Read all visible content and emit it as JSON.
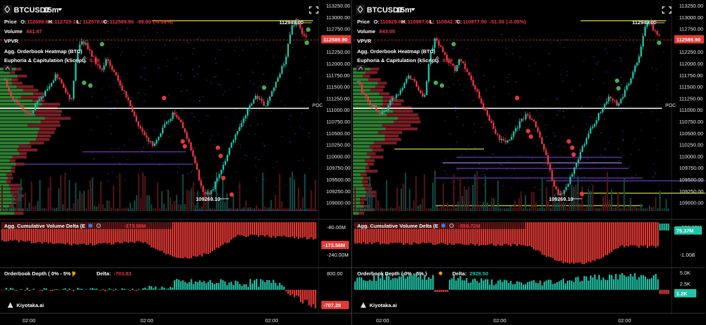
{
  "panels": [
    {
      "symbol": "BTCUSDT",
      "interval": "15m",
      "price_label": "Price",
      "ohlc": {
        "o": "112689.80",
        "h": "112729.10",
        "l": "112570.00",
        "c": "112589.90",
        "chg": "-99.90",
        "pct": "(-0.09%)"
      },
      "volume_label": "Volume",
      "volume_value": "441.87",
      "indicators": [
        "VPVR",
        "Agg. Orderbook Heatmap (BTC)",
        "Euphoria & Capitulation (kScript)"
      ],
      "euphoria_value": "0.00",
      "price_axis": [
        "113250.00",
        "113000.00",
        "112750.00",
        "112500.00",
        "112250.00",
        "112000.00",
        "111750.00",
        "111500.00",
        "111250.00",
        "111000.00",
        "110750.00",
        "110500.00",
        "110250.00",
        "110000.00",
        "109750.00",
        "109500.00",
        "109250.00",
        "109000.00"
      ],
      "current_price_tag": "112589.90",
      "high_label": "112949.00",
      "low_label": "109269.10",
      "poc_label": "POC",
      "cvd_title": "Agg. Cumulative Volume Delta (E",
      "cvd_value": "-173.56M",
      "cvd_axis": [
        "-80.00M",
        "-240.00M"
      ],
      "cvd_tag": "-173.56M",
      "ob_title": "Orderbook Depth ( 0% - 5% )",
      "delta_label": "Delta:",
      "delta_value": "-703.83",
      "ob_axis": [
        "800.00"
      ],
      "ob_tag": "-707.28",
      "time_labels": [
        "02:00",
        "02:00",
        "02:00"
      ],
      "brand": "Kiyotaka.ai"
    },
    {
      "symbol": "BTCUSDT",
      "interval": "15m",
      "price_label": "Price",
      "ohlc": {
        "o": "110928.80",
        "h": "110997.60",
        "l": "110842.70",
        "c": "110877.50",
        "chg": "-51.30",
        "pct": "(-0.05%)"
      },
      "volume_label": "Volume",
      "volume_value": "843.05",
      "indicators": [
        "VPVR",
        "Agg. Orderbook Heatmap (BTC)",
        "Euphoria & Capitulation (kScript)"
      ],
      "euphoria_value": "0.00",
      "price_axis": [
        "113250.00",
        "113000.00",
        "112750.00",
        "112500.00",
        "112250.00",
        "112000.00",
        "111750.00",
        "111500.00",
        "111250.00",
        "111000.00",
        "110750.00",
        "110500.00",
        "110250.00",
        "110000.00",
        "109750.00",
        "109500.00",
        "109250.00",
        "109000.00"
      ],
      "current_price_tag": "112589.90",
      "high_label": "112949.00",
      "low_label": "109269.10",
      "poc_label": "POC",
      "cvd_title": "Agg. Cumulative Volume Delta (E",
      "cvd_value": "-559.72M",
      "cvd_axis": [
        "-500.00M",
        "-1.00B"
      ],
      "cvd_tag": "75.37M",
      "ob_title": "Orderbook Depth ( 0% - 5% )",
      "delta_label": "Delta:",
      "delta_value": "2928.50",
      "ob_axis": [
        "5.0K",
        "2.5K",
        "1.2K"
      ],
      "ob_tag": "1.2K",
      "time_labels": [
        "02:00",
        "02:00",
        "02:00"
      ],
      "brand": "Kiyotaka.ai"
    }
  ],
  "colors": {
    "up": "#26a69a",
    "teal": "#20c4a8",
    "down": "#f23645",
    "bg": "#000000",
    "poc": "#ffffff",
    "signal_green": "#4caf50",
    "high_line": "#e6e61e"
  },
  "chart_data": {
    "type": "candlestick",
    "interval": "15m",
    "price_range": [
      109000,
      113250
    ],
    "key_levels": {
      "high": 112949.0,
      "low": 109269.1,
      "last_close": 112589.9
    },
    "approx_close_path": [
      111700,
      111400,
      111250,
      111150,
      111050,
      111000,
      111200,
      111350,
      111450,
      111600,
      111800,
      111650,
      111450,
      111300,
      112150,
      112550,
      112400,
      112200,
      112050,
      111900,
      112150,
      111950,
      111750,
      111500,
      111300,
      111050,
      110800,
      110600,
      110450,
      110350,
      110500,
      110700,
      110850,
      111000,
      110900,
      110700,
      110400,
      110050,
      109650,
      109350,
      109300,
      109500,
      109750,
      110000,
      110300,
      110550,
      110750,
      110950,
      111150,
      111350,
      111300,
      111150,
      111400,
      111650,
      111900,
      112150,
      112750,
      112949,
      112700,
      112590
    ]
  }
}
